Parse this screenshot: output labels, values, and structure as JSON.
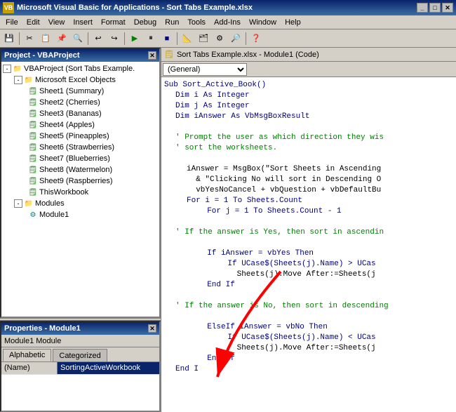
{
  "titleBar": {
    "title": "Microsoft Visual Basic for Applications - Sort Tabs Example.xlsx",
    "controls": [
      "_",
      "□",
      "✕"
    ]
  },
  "menuBar": {
    "items": [
      "File",
      "Edit",
      "View",
      "Insert",
      "Format",
      "Debug",
      "Run",
      "Tools",
      "Add-Ins",
      "Window",
      "Help"
    ]
  },
  "projectPanel": {
    "title": "Project - VBAProject",
    "tree": {
      "root": "VBAProject (Sort Tabs Example.",
      "children": [
        {
          "label": "Microsoft Excel Objects",
          "expanded": true,
          "children": [
            {
              "label": "Sheet1 (Summary)"
            },
            {
              "label": "Sheet2 (Cherries)"
            },
            {
              "label": "Sheet3 (Bananas)"
            },
            {
              "label": "Sheet4 (Apples)"
            },
            {
              "label": "Sheet5 (Pineapples)"
            },
            {
              "label": "Sheet6 (Strawberries)"
            },
            {
              "label": "Sheet7 (Blueberries)"
            },
            {
              "label": "Sheet8 (Watermelon)"
            },
            {
              "label": "Sheet9 (Raspberries)"
            },
            {
              "label": "ThisWorkbook"
            }
          ]
        },
        {
          "label": "Modules",
          "expanded": true,
          "children": [
            {
              "label": "Module1"
            }
          ]
        }
      ]
    }
  },
  "propertiesPanel": {
    "title": "Properties - Module1",
    "moduleLabel": "Module1  Module",
    "tabs": [
      "Alphabetic",
      "Categorized"
    ],
    "activeTab": "Alphabetic",
    "property": {
      "name": "(Name)",
      "value": "SortingActiveWorkbook"
    }
  },
  "codePanel": {
    "title": "Sort Tabs Example.xlsx - Module1 (Code)",
    "general": "(General)",
    "lines": [
      {
        "text": "Sub Sort_Active_Book()",
        "type": "keyword"
      },
      {
        "text": "Dim i As Integer",
        "type": "keyword",
        "indent": 1
      },
      {
        "text": "Dim j As Integer",
        "type": "keyword",
        "indent": 1
      },
      {
        "text": "Dim iAnswer As VbMsgBoxResult",
        "type": "keyword",
        "indent": 1
      },
      {
        "text": "",
        "type": "text"
      },
      {
        "text": "' Prompt the user as which direction they wis",
        "type": "comment",
        "indent": 1
      },
      {
        "text": "' sort the worksheets.",
        "type": "comment",
        "indent": 1
      },
      {
        "text": "",
        "type": "text"
      },
      {
        "text": "iAnswer = MsgBox(\"Sort Sheets in Ascending",
        "type": "text",
        "indent": 2
      },
      {
        "text": "& \"Clicking No will sort in Descending O",
        "type": "text",
        "indent": 2
      },
      {
        "text": "vbYesNoCancel + vbQuestion + vbDefaultBu",
        "type": "text",
        "indent": 2
      },
      {
        "text": "For i = 1 To Sheets.Count",
        "type": "keyword",
        "indent": 2
      },
      {
        "text": "For j = 1 To Sheets.Count - 1",
        "type": "keyword",
        "indent": 3
      },
      {
        "text": "",
        "type": "text"
      },
      {
        "text": "' If the answer is Yes, then sort in ascendin",
        "type": "comment",
        "indent": 1
      },
      {
        "text": "",
        "type": "text"
      },
      {
        "text": "If iAnswer = vbYes Then",
        "type": "keyword",
        "indent": 3
      },
      {
        "text": "If UCase$(Sheets(j).Name) > UCas",
        "type": "keyword",
        "indent": 4
      },
      {
        "text": "Sheets(j).Move After:=Sheets(j",
        "type": "text",
        "indent": 4
      },
      {
        "text": "End If",
        "type": "keyword",
        "indent": 3
      },
      {
        "text": "",
        "type": "text"
      },
      {
        "text": "' If the answer is No, then sort in descending",
        "type": "comment",
        "indent": 1
      },
      {
        "text": "",
        "type": "text"
      },
      {
        "text": "ElseIf iAnswer = vbNo Then",
        "type": "keyword",
        "indent": 3
      },
      {
        "text": "If UCase$(Sheets(j).Name) < UCas",
        "type": "keyword",
        "indent": 4
      },
      {
        "text": "Sheets(j).Move After:=Sheets(j",
        "type": "text",
        "indent": 4
      },
      {
        "text": "End If",
        "type": "keyword",
        "indent": 3
      },
      {
        "text": "End I",
        "type": "keyword",
        "indent": 1
      }
    ]
  }
}
